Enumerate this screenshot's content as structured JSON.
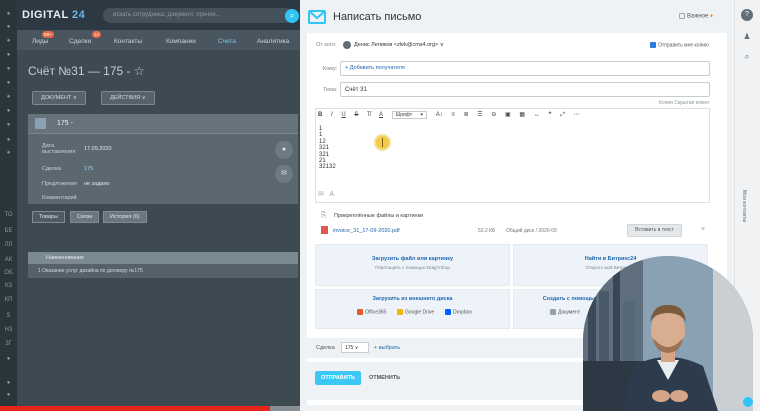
{
  "crm": {
    "logo_prefix": "DIGITAL",
    "logo_num": "24",
    "search_placeholder": "искать сотрудника, документ, прочее...",
    "menu": [
      "Лиды",
      "Сделки",
      "Контакты",
      "Компании",
      "Счета",
      "Аналитика"
    ],
    "badges": [
      "99+",
      "12"
    ],
    "deal_title": "Счёт №31 — 175 - ☆",
    "btn_document": "ДОКУМЕНТ  ∨",
    "btn_actions": "ДЕЙСТВИЯ  ∨",
    "card_number": "175 -",
    "rows": [
      {
        "label": "Дата выставления",
        "value": "17.09.2020"
      },
      {
        "label": "Сделка",
        "value": "175"
      },
      {
        "label": "Предложение",
        "value": "не задано"
      },
      {
        "label": "Комментарий",
        "value": ""
      }
    ],
    "tabs": [
      "Товары",
      "Связи",
      "История (6)"
    ],
    "table_header": "Наименование",
    "table_row": "1    Оказание услуг дизайна по договору №175",
    "left_nav": [
      "",
      "",
      "",
      "",
      "",
      "",
      "",
      "",
      "",
      "",
      "",
      "ТО",
      "БЕ",
      "ЛЛ",
      "АК",
      "ОБ",
      "КЗ",
      "КП",
      "S",
      "НЗ",
      "ЗГ",
      "",
      "",
      ""
    ]
  },
  "email": {
    "title": "Написать письмо",
    "important_label": "Важное",
    "from_label": "От кого:",
    "from_value": "Денис Лепиков <zlek@cms4.org> ∨",
    "send_copy": "Отправить мне копию",
    "to_label": "Кому:",
    "add_recipients": "+ Добавить получателя",
    "subject_label": "Тема:",
    "subject_value": "Счёт 31",
    "copy_links": "Копия   Скрытая копия",
    "font_label": "Шрифт",
    "body_lines": [
      "1",
      "1",
      "12",
      "321",
      "321",
      "21",
      "32132"
    ],
    "attached_label": "Прикреплённые файлы и картинки",
    "file_name": "invoice_31_17-09-2020.pdf",
    "file_size": "53.2 КБ",
    "file_disk": "Общий диск / 2020-09",
    "insert_text": "Вставить в текст",
    "upload_file_title": "Загрузить файл или картинку",
    "upload_file_sub": "Перетащить с помощью Drag'n'drop",
    "find_bitrix_title": "Найти в Битрикс24",
    "find_bitrix_sub": "Открыть мой Битрикс24",
    "upload_external_title": "Загрузить из внешнего диска",
    "services": [
      "Office365",
      "Google Drive",
      "Dropbox"
    ],
    "create_help_title": "Создать с помощью",
    "create_doc": "Документ",
    "deal_label": "Сделка",
    "deal_value": "175 ∨",
    "deal_add": "+ выбрать",
    "send_button": "ОТПРАВИТЬ",
    "cancel_button": "ОТМЕНИТЬ"
  },
  "right_strip": {
    "vertical_label": "Мои контакты"
  },
  "colors": {
    "accent": "#3bc8f5",
    "link": "#2067b0",
    "progress": "#e5261c"
  }
}
